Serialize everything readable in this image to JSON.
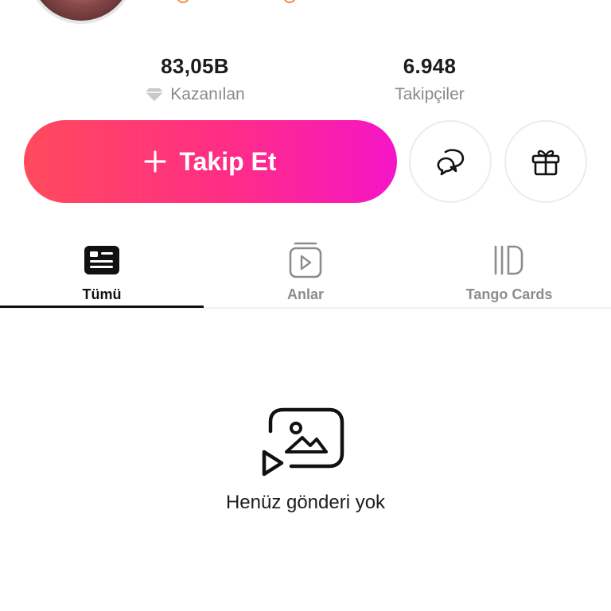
{
  "profile": {
    "stats": {
      "earned_value": "83,05B",
      "earned_label": "Kazanılan",
      "followers_value": "6.948",
      "followers_label": "Takipçiler"
    }
  },
  "actions": {
    "follow_label": "Takip Et",
    "follow_icon": "plus-icon",
    "chat_icon": "chat-bubbles-icon",
    "gift_icon": "gift-icon",
    "accent_start": "#ff4a5c",
    "accent_end": "#f515c7"
  },
  "tabs": [
    {
      "label": "Tümü",
      "icon": "feed-card-icon",
      "active": true
    },
    {
      "label": "Anlar",
      "icon": "moments-video-icon",
      "active": false
    },
    {
      "label": "Tango Cards",
      "icon": "cards-stack-icon",
      "active": false
    }
  ],
  "empty_state": {
    "icon": "media-gallery-icon",
    "text": "Henüz gönderi yok"
  }
}
